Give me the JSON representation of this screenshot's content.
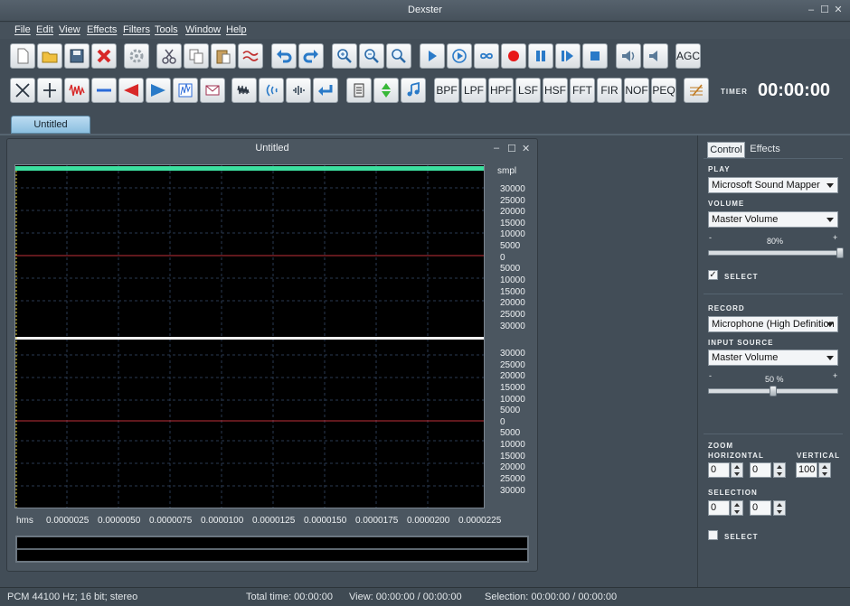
{
  "window": {
    "title": "Dexster",
    "doc_title": "Untitled"
  },
  "menu": [
    "File",
    "Edit",
    "View",
    "Effects",
    "Filters",
    "Tools",
    "Window",
    "Help"
  ],
  "toolbar1": {
    "agc_label": "AGC"
  },
  "toolbar2": {
    "filters": [
      "BPF",
      "LPF",
      "HPF",
      "LSF",
      "HSF",
      "FFT",
      "FIR",
      "NOF",
      "PEQ"
    ]
  },
  "timer": {
    "label": "TIMER",
    "value": "00:00:00"
  },
  "doc_tab": "Untitled",
  "waveform": {
    "unit_label": "smpl",
    "channel1_ticks": [
      "30000",
      "25000",
      "20000",
      "15000",
      "10000",
      "5000",
      "0",
      "5000",
      "10000",
      "15000",
      "20000",
      "25000",
      "30000"
    ],
    "channel2_ticks": [
      "30000",
      "25000",
      "20000",
      "15000",
      "10000",
      "5000",
      "0",
      "5000",
      "10000",
      "15000",
      "20000",
      "25000",
      "30000"
    ],
    "time_unit": "hms",
    "time_ticks": [
      "0.0000025",
      "0.0000050",
      "0.0000075",
      "0.0000100",
      "0.0000125",
      "0.0000150",
      "0.0000175",
      "0.0000200",
      "0.0000225"
    ],
    "colors": {
      "background": "#000000",
      "center_line": "#c0303a",
      "selection_bar": "#3de0a0",
      "grid": "#2a3a52"
    }
  },
  "side_panel": {
    "tabs": [
      "Control",
      "Effects"
    ],
    "play": {
      "label": "PLAY",
      "device": "Microsoft Sound Mapper",
      "volume_label": "VOLUME",
      "volume_source": "Master Volume",
      "minus": "-",
      "plus": "+",
      "level_text": "80%",
      "level": 0.8,
      "select_label": "SELECT",
      "select_checked": true
    },
    "record": {
      "label": "RECORD",
      "device": "Microphone (High Definition",
      "input_label": "INPUT SOURCE",
      "input_source": "Master Volume",
      "minus": "-",
      "plus": "+",
      "level_text": "50 %",
      "level": 0.5
    },
    "zoom": {
      "label": "ZOOM",
      "horizontal_label": "HORIZONTAL",
      "vertical_label": "VERTICAL",
      "h1": "0",
      "h2": "0",
      "vertical": "100"
    },
    "selection": {
      "label": "SELECTION",
      "s1": "0",
      "s2": "0",
      "select_label": "SELECT",
      "select_checked": false
    }
  },
  "status": {
    "format": "PCM 44100 Hz; 16 bit; stereo",
    "total_time": "Total time: 00:00:00",
    "view": "View: 00:00:00 / 00:00:00",
    "selection": "Selection: 00:00:00 / 00:00:00"
  }
}
